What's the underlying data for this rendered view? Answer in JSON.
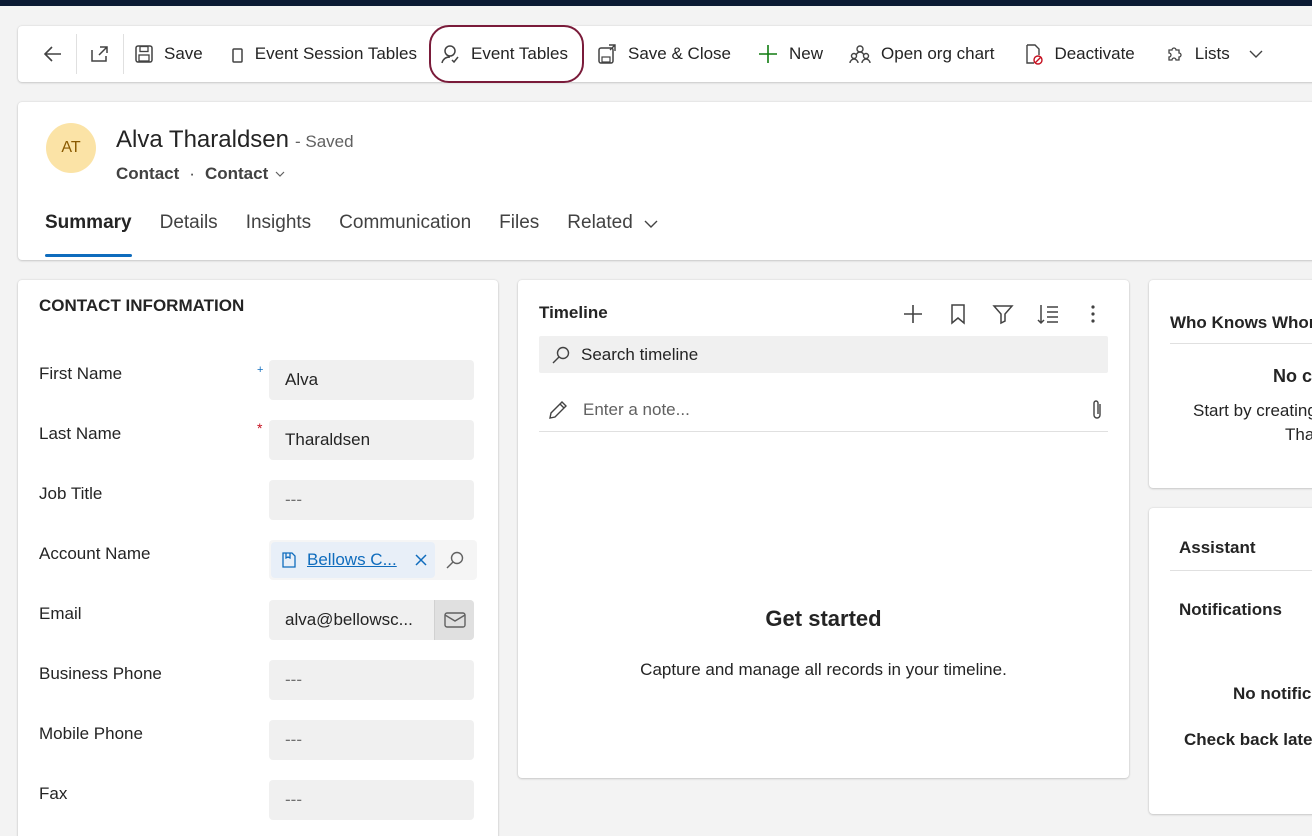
{
  "commandbar": {
    "back_icon": "arrow-left-icon",
    "popout_icon": "open-in-new-window-icon",
    "save": "Save",
    "event_session_tables": "Event Session Tables",
    "event_tables": "Event Tables",
    "save_close": "Save & Close",
    "new": "New",
    "open_org_chart": "Open org chart",
    "deactivate": "Deactivate",
    "lists": "Lists"
  },
  "record": {
    "initials": "AT",
    "name": "Alva Tharaldsen",
    "status": "- Saved",
    "entity": "Contact",
    "form": "Contact",
    "avatar_color": "#fbe3a6"
  },
  "tabs": [
    "Summary",
    "Details",
    "Insights",
    "Communication",
    "Files",
    "Related"
  ],
  "contact": {
    "section_title": "CONTACT INFORMATION",
    "fields": [
      {
        "label": "First Name",
        "value": "Alva"
      },
      {
        "label": "Last Name",
        "value": "Tharaldsen"
      },
      {
        "label": "Job Title",
        "value": "---"
      },
      {
        "label": "Account Name",
        "value": "Bellows C..."
      },
      {
        "label": "Email",
        "value": "alva@bellowsc..."
      },
      {
        "label": "Business Phone",
        "value": "---"
      },
      {
        "label": "Mobile Phone",
        "value": "---"
      },
      {
        "label": "Fax",
        "value": "---"
      }
    ]
  },
  "timeline": {
    "title": "Timeline",
    "search_placeholder": "Search timeline",
    "note_placeholder": "Enter a note...",
    "empty_title": "Get started",
    "empty_sub": "Capture and manage all records in your timeline."
  },
  "who_knows_whom": {
    "title": "Who Knows Whom",
    "no_connections": "No co",
    "start_by": "Start by creating",
    "thara": "Thara"
  },
  "assistant": {
    "title": "Assistant",
    "notifications": "Notifications",
    "no_notifications": "No notific",
    "check_back": "Check back later"
  },
  "colors": {
    "accent": "#0f6cbd",
    "highlight_border": "#7a1b3a",
    "required": "#c50f1f",
    "topbar": "#0b1a33"
  }
}
